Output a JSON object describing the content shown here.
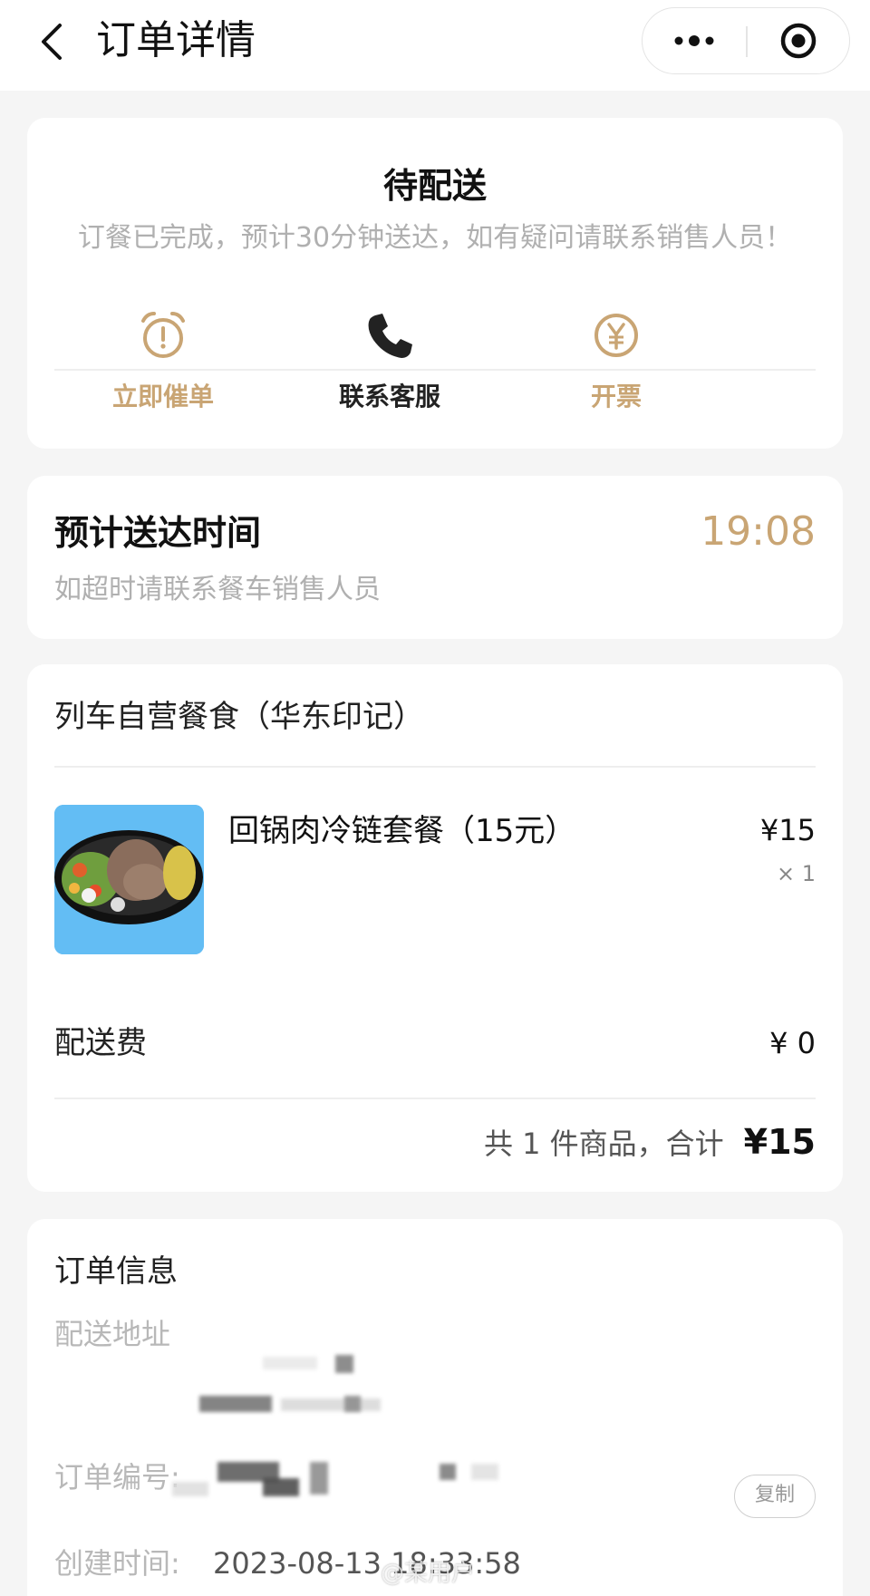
{
  "header": {
    "title": "订单详情"
  },
  "status": {
    "title": "待配送",
    "description": "订餐已完成，预计30分钟送达，如有疑问请联系销售人员！",
    "actions": [
      {
        "label": "立即催单",
        "icon": "alarm-clock-icon",
        "color": "#c9a574"
      },
      {
        "label": "联系客服",
        "icon": "phone-icon",
        "color": "#222222"
      },
      {
        "label": "开票",
        "icon": "yuan-coin-icon",
        "color": "#c9a574"
      }
    ]
  },
  "delivery": {
    "title": "预计送达时间",
    "time": "19:08",
    "note": "如超时请联系餐车销售人员"
  },
  "order": {
    "shop_name": "列车自营餐食（华东印记）",
    "product": {
      "name": "回锅肉冷链套餐（15元）",
      "price": "¥15",
      "quantity": "× 1"
    },
    "delivery_fee_label": "配送费",
    "delivery_fee": "¥ 0",
    "summary": "共 1 件商品，合计",
    "total": "¥15"
  },
  "info": {
    "title": "订单信息",
    "address_label": "配送地址",
    "order_no_label": "订单编号:",
    "copy_label": "复制",
    "created_label": "创建时间:",
    "created_value": "2023-08-13 18:33:58"
  },
  "watermark": "@某用户",
  "colors": {
    "accent": "#c9a574",
    "background": "#f5f5f5",
    "card": "#ffffff"
  }
}
